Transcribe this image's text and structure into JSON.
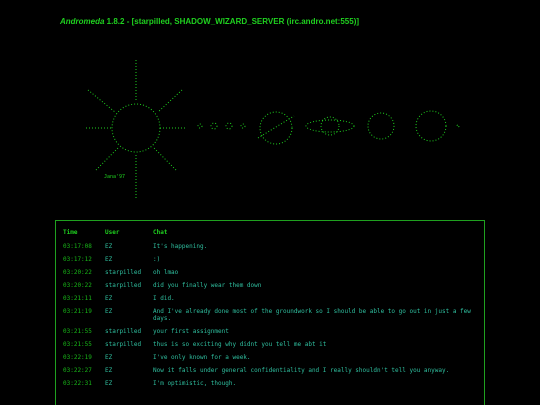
{
  "header": {
    "app_name": "Andromeda",
    "version_info": " 1.8.2 - [starpilled, SHADOW_WIZARD_SERVER (irc.andro.net:555)]"
  },
  "art": {
    "signature": "Jana'97",
    "color": "#1fd11f"
  },
  "chat": {
    "columns": [
      "Time",
      "User",
      "Chat"
    ],
    "rows": [
      {
        "time": "03:17:08",
        "user": "EZ",
        "msg": "It's happening."
      },
      {
        "time": "03:17:12",
        "user": "EZ",
        "msg": ":)"
      },
      {
        "time": "03:20:22",
        "user": "starpilled",
        "msg": "oh lmao"
      },
      {
        "time": "03:20:22",
        "user": "starpilled",
        "msg": "did you finally wear them down"
      },
      {
        "time": "03:21:11",
        "user": "EZ",
        "msg": "I did."
      },
      {
        "time": "03:21:19",
        "user": "EZ",
        "msg": "And I've already done most of the groundwork so I should be able to go out in just a few days."
      },
      {
        "time": "03:21:55",
        "user": "starpilled",
        "msg": "your first assignment"
      },
      {
        "time": "03:21:55",
        "user": "starpilled",
        "msg": "thus is so exciting why didnt you tell me abt it"
      },
      {
        "time": "03:22:19",
        "user": "EZ",
        "msg": "I've only known for a week."
      },
      {
        "time": "03:22:27",
        "user": "EZ",
        "msg": "Now it falls under general confidentiality and I really shouldn't tell you anyway."
      },
      {
        "time": "03:22:31",
        "user": "EZ",
        "msg": "I'm optimistic, though."
      }
    ]
  },
  "colors": {
    "background": "#000000",
    "primary_green": "#1fd11f",
    "cyan_text": "#2fbf9f"
  }
}
